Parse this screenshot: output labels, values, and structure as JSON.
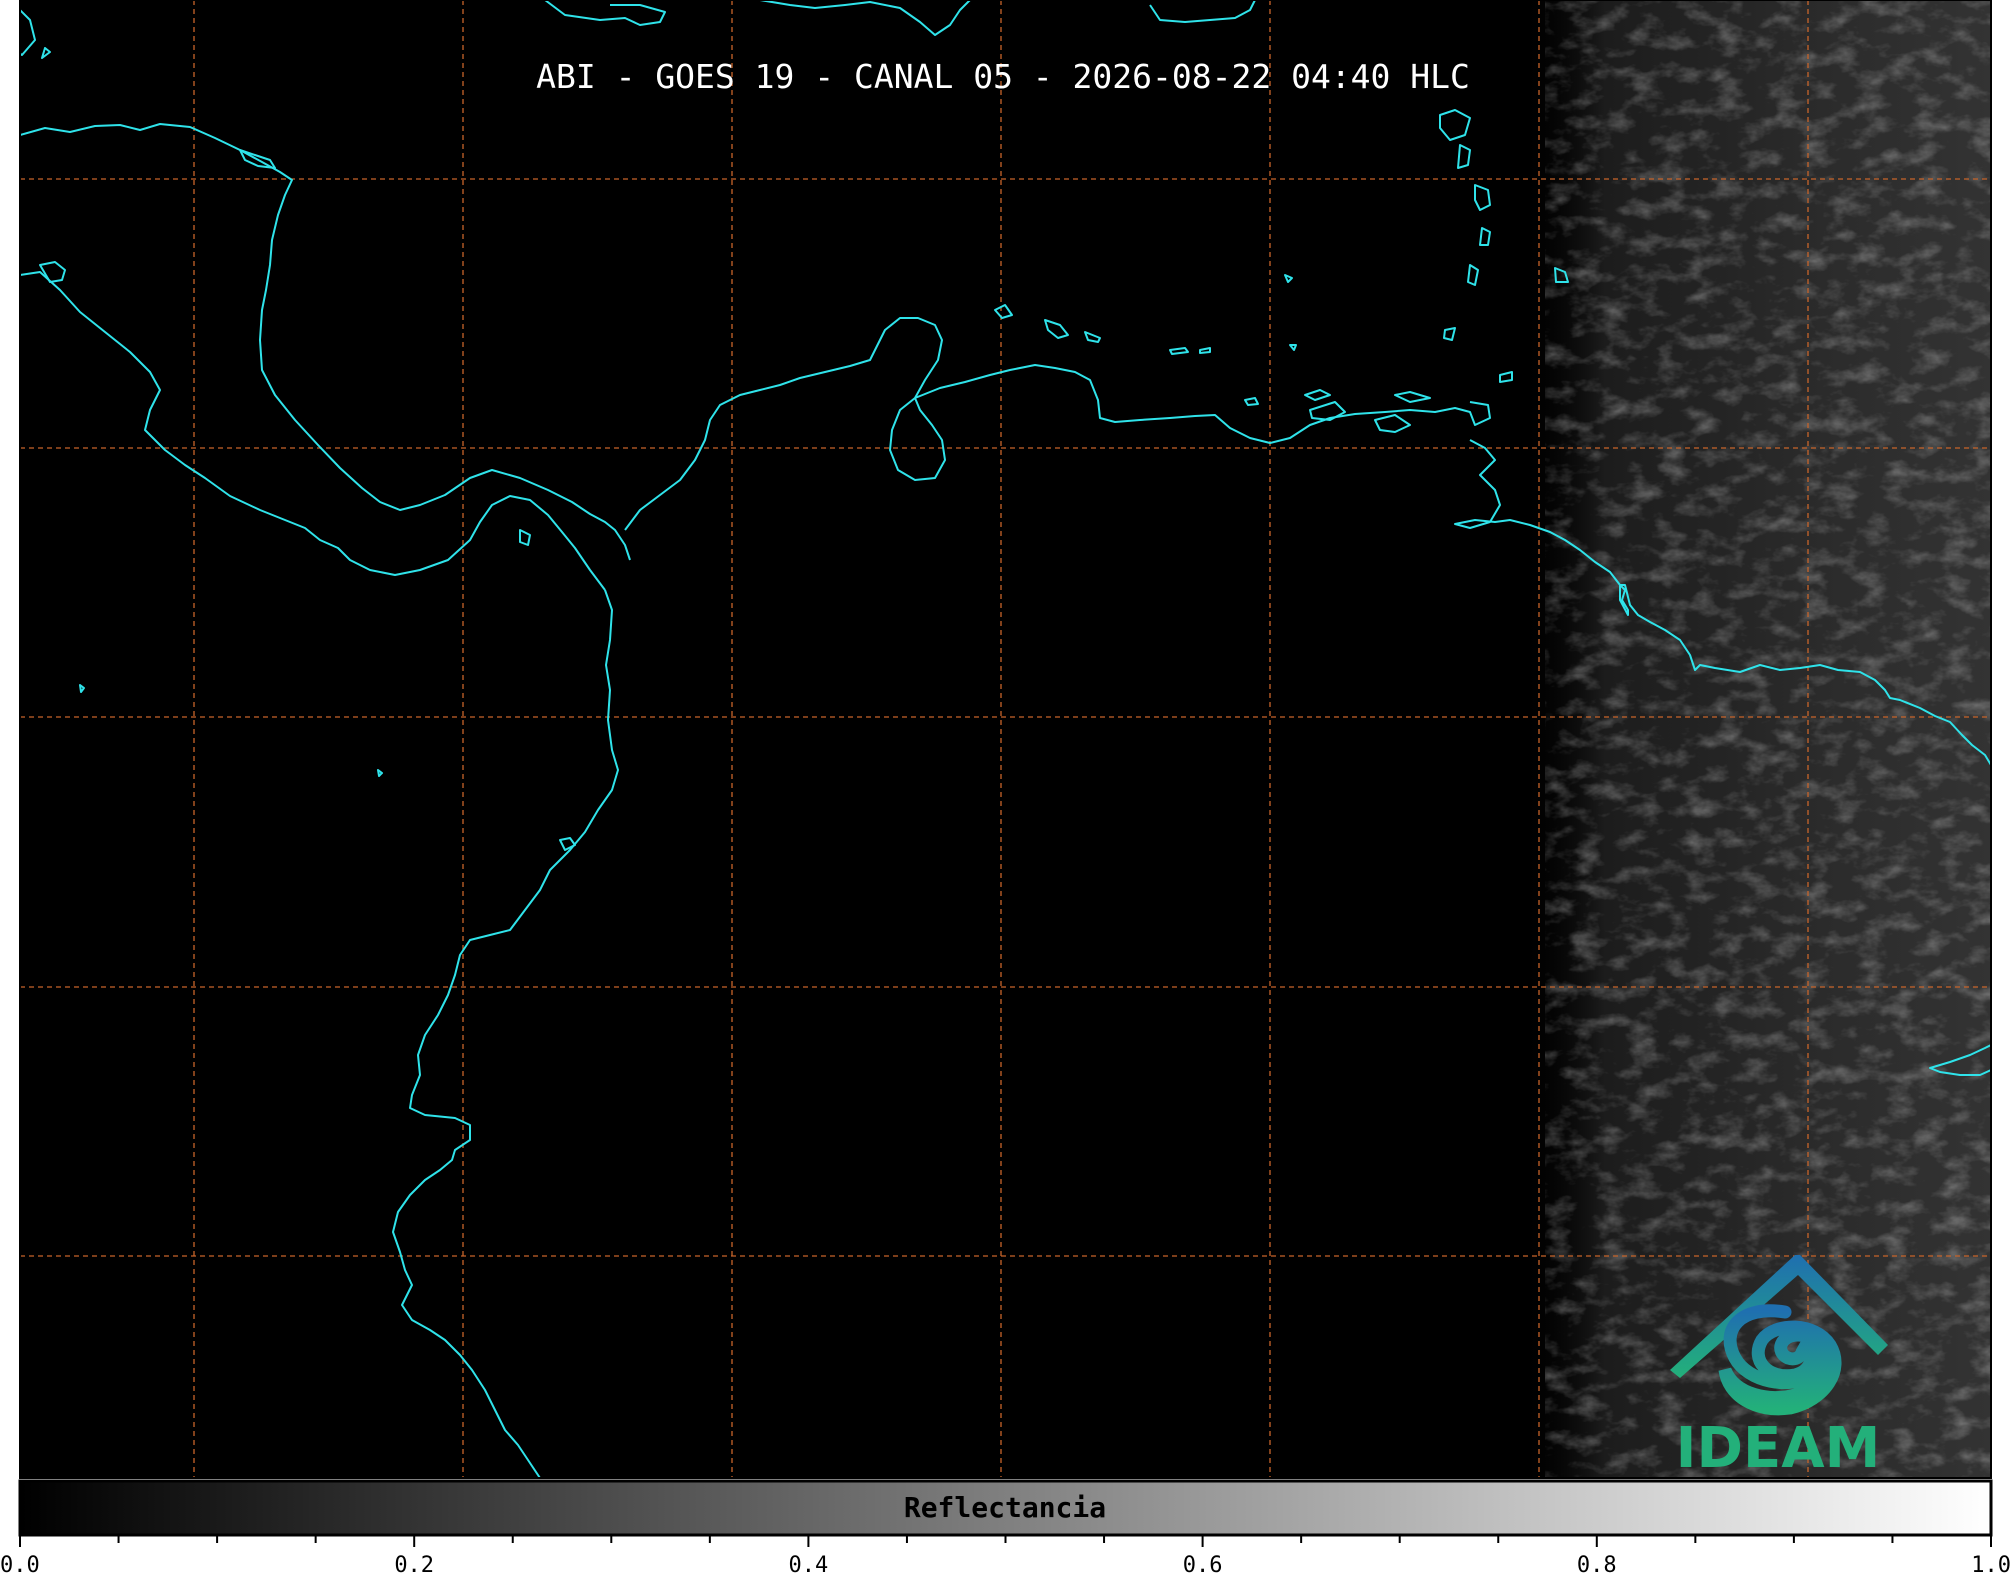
{
  "title": "ABI - GOES 19 - CANAL 05 - 2026-08-22 04:40 HLC",
  "colorbar": {
    "label": "Reflectancia",
    "range": [
      0.0,
      1.0
    ],
    "major_ticks": [
      "0.0",
      "0.2",
      "0.4",
      "0.6",
      "0.8",
      "1.0"
    ],
    "minor_step": 0.05,
    "colormap": "grayscale black-to-white"
  },
  "map": {
    "background": "#000000",
    "coastline_color": "#2fe3ea",
    "gridline_color": "#c8642a",
    "gridline_style": "dashed",
    "grid": true
  },
  "logo": {
    "text": "IDEAM",
    "icon": "ideam-logo-icon",
    "color_top": "#1f6fb0",
    "color_bottom": "#23b07a"
  }
}
